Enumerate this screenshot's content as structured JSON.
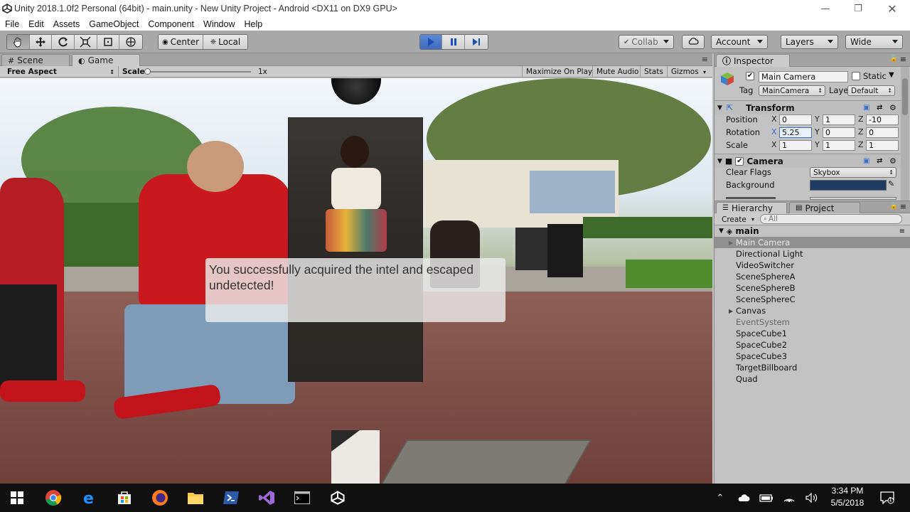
{
  "window": {
    "title": "Unity 2018.1.0f2 Personal (64bit) - main.unity - New Unity Project - Android <DX11 on DX9 GPU>"
  },
  "menu": [
    "File",
    "Edit",
    "Assets",
    "GameObject",
    "Component",
    "Window",
    "Help"
  ],
  "toolbar": {
    "pivot_label": "Center",
    "space_label": "Local",
    "collab_label": "Collab",
    "account_label": "Account",
    "layers_label": "Layers",
    "layout_label": "Wide"
  },
  "scene_panel": {
    "tabs": [
      {
        "label": "Scene"
      },
      {
        "label": "Game"
      }
    ],
    "aspect_label": "Free Aspect",
    "scale_label": "Scale",
    "scale_value": "1x",
    "maximize_label": "Maximize On Play",
    "mute_label": "Mute Audio",
    "stats_label": "Stats",
    "gizmos_label": "Gizmos"
  },
  "game": {
    "message": "You successfully acquired the intel and escaped undetected!"
  },
  "inspector": {
    "tab_label": "Inspector",
    "object_name": "Main Camera",
    "static_label": "Static",
    "tag_label": "Tag",
    "tag_value": "MainCamera",
    "layer_label": "Layer",
    "layer_value": "Default",
    "transform_title": "Transform",
    "position_label": "Position",
    "rotation_label": "Rotation",
    "scale_label": "Scale",
    "axis_x": "X",
    "axis_y": "Y",
    "axis_z": "Z",
    "position": {
      "x": "0",
      "y": "1",
      "z": "-10"
    },
    "rotation": {
      "x": "5.25",
      "y": "0",
      "z": "0"
    },
    "scale": {
      "x": "1",
      "y": "1",
      "z": "1"
    },
    "camera_title": "Camera",
    "clear_flags_label": "Clear Flags",
    "clear_flags_value": "Skybox",
    "background_label": "Background",
    "background_color": "#1f3b63"
  },
  "hierarchy": {
    "tab_label": "Hierarchy",
    "project_tab_label": "Project",
    "create_label": "Create",
    "search_placeholder": "All",
    "scene_name": "main",
    "items": [
      {
        "label": "Main Camera"
      },
      {
        "label": "Directional Light"
      },
      {
        "label": "VideoSwitcher"
      },
      {
        "label": "SceneSphereA"
      },
      {
        "label": "SceneSphereB"
      },
      {
        "label": "SceneSphereC"
      },
      {
        "label": "Canvas"
      },
      {
        "label": "EventSystem"
      },
      {
        "label": "SpaceCube1"
      },
      {
        "label": "SpaceCube2"
      },
      {
        "label": "SpaceCube3"
      },
      {
        "label": "TargetBillboard"
      },
      {
        "label": "Quad"
      }
    ]
  },
  "taskbar": {
    "time": "3:34 PM",
    "date": "5/5/2018",
    "notification_count": "1"
  }
}
